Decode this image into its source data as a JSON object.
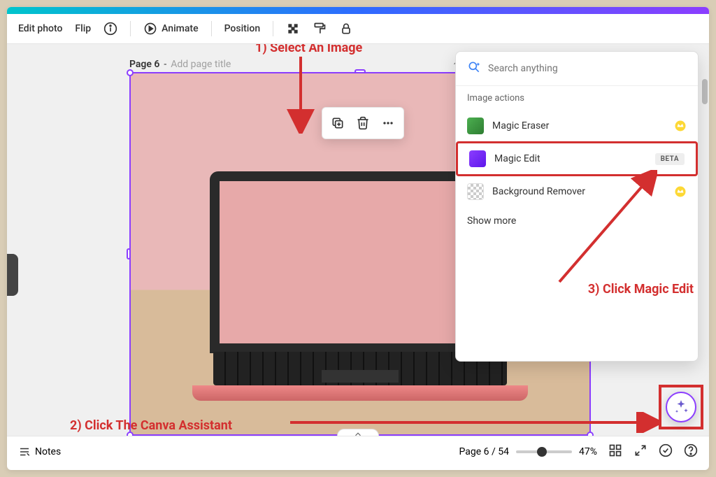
{
  "toolbar": {
    "edit_photo": "Edit photo",
    "flip": "Flip",
    "animate": "Animate",
    "position": "Position"
  },
  "page": {
    "label": "Page 6",
    "title_placeholder": "Add page title"
  },
  "assistant": {
    "search_placeholder": "Search anything",
    "section_header": "Image actions",
    "items": [
      {
        "label": "Magic Eraser",
        "badge": "",
        "crown": true
      },
      {
        "label": "Magic Edit",
        "badge": "BETA",
        "crown": false
      },
      {
        "label": "Background Remover",
        "badge": "",
        "crown": true
      }
    ],
    "show_more": "Show more"
  },
  "bottom": {
    "notes": "Notes",
    "page_counter": "Page 6 / 54",
    "zoom": "47%"
  },
  "annotations": {
    "step1": "1) Select An Image",
    "step2": "2) Click The Canva Assistant",
    "step3": "3) Click Magic Edit"
  }
}
